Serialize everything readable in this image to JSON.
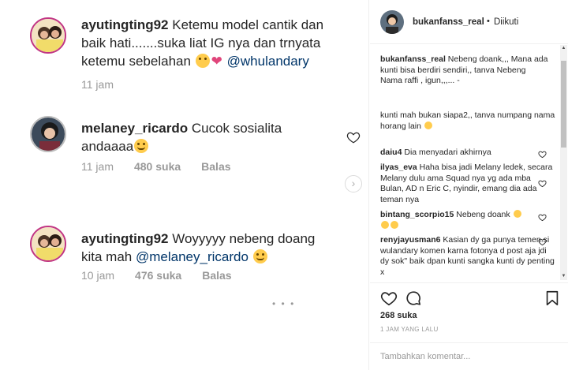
{
  "left_comments": [
    {
      "user": "ayutingting92",
      "text_line1": " Ketemu model cantik dan",
      "text_line2": "baik hati.......suka liat IG nya dan trnyata",
      "text_line3_pre": "ketemu sebelahan ",
      "mention": "@whulandary",
      "time": "11 jam",
      "likes": "",
      "reply": ""
    },
    {
      "user": "melaney_ricardo",
      "text_line1": " Cucok sosialita",
      "text_line2": "andaaaa",
      "time": "11 jam",
      "likes": "480 suka",
      "reply": "Balas"
    },
    {
      "user": "ayutingting92",
      "text_line1": " Woyyyyy nebeng doang",
      "text_line2_pre": "kita mah ",
      "mention": "@melaney_ricardo",
      "time": "10 jam",
      "likes": "476 suka",
      "reply": "Balas"
    }
  ],
  "sidebar": {
    "username": "bukanfanss_real",
    "dot": "•",
    "follow_status": "Diikuti",
    "caption_user": "bukanfanss_real",
    "caption_text": " Nebeng doank,,, Mana ada kunti bisa berdiri sendiri,, tanva Nebeng",
    "caption_line2": "Nama raffi , igun,,,... -",
    "caption_line3": "kunti mah bukan siapa2,, tanva numpang nama",
    "caption_line4": "horang lain",
    "comments": [
      {
        "user": "daiu4",
        "text": " Dia menyadari akhirnya"
      },
      {
        "user": "ilyas_eva",
        "text": " Haha bisa jadi Melany ledek, secara Melany dulu ama Squad nya yg ada mba Bulan, AD n Eric C, nyindir, emang dia ada teman nya"
      },
      {
        "user": "bintang_scorpio15",
        "text": " Nebeng doank"
      },
      {
        "user": "renyjayusman6",
        "text": " Kasian dy ga punya temen.si wulandary komen karna fotonya d post aja jdi dy sok\" baik dpan kunti sangka kunti dy penting x"
      }
    ],
    "likes": "268 suka",
    "time": "1 JAM YANG LALU",
    "comment_placeholder": "Tambahkan komentar..."
  },
  "colors": {
    "mention": "#003569",
    "meta_gray": "#999999",
    "text": "#262626",
    "emoji_yellow": "#ffcc4d",
    "heart_pink": "#e0457b"
  },
  "icons": [
    "heart-icon",
    "speech-bubble-icon",
    "bookmark-icon",
    "chevron-right-icon"
  ]
}
